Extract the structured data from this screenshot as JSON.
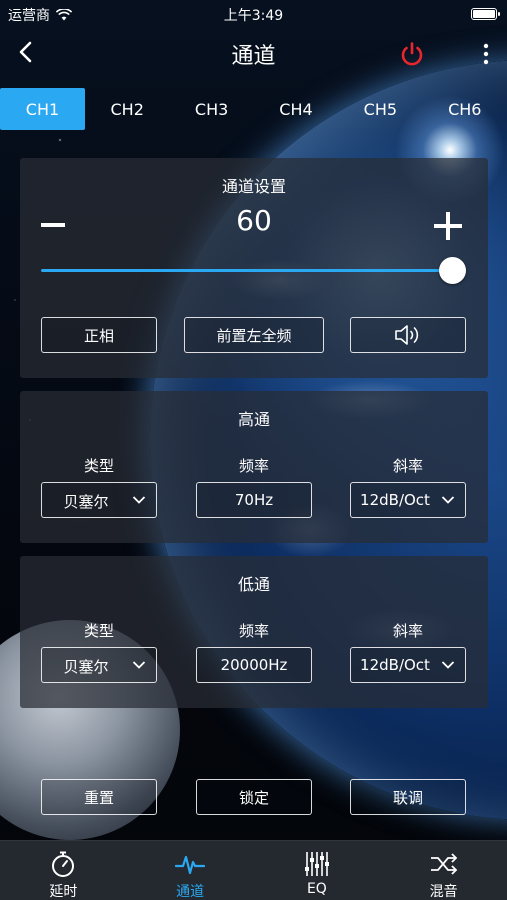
{
  "colors": {
    "accent": "#2aa8f2",
    "power": "#e8262c",
    "panel": "rgba(40,44,52,0.72)",
    "bottombar": "#262a32"
  },
  "status_bar": {
    "carrier": "运营商",
    "time": "上午3:49",
    "icons": [
      "wifi-icon",
      "battery-icon"
    ]
  },
  "nav": {
    "title": "通道",
    "icons": [
      "back-icon",
      "power-icon",
      "more-icon"
    ]
  },
  "tabs": [
    {
      "label": "CH1",
      "active": true
    },
    {
      "label": "CH2",
      "active": false
    },
    {
      "label": "CH3",
      "active": false
    },
    {
      "label": "CH4",
      "active": false
    },
    {
      "label": "CH5",
      "active": false
    },
    {
      "label": "CH6",
      "active": false
    }
  ],
  "channel_settings": {
    "title": "通道设置",
    "value": "60",
    "slider_level": 1.0,
    "minus_icon": "minus-icon",
    "plus_icon": "plus-icon",
    "buttons": {
      "phase": "正相",
      "source": "前置左全频",
      "speaker_icon": "speaker-icon"
    }
  },
  "highpass": {
    "title": "高通",
    "type_label": "类型",
    "freq_label": "频率",
    "slope_label": "斜率",
    "type_value": "贝塞尔",
    "freq_value": "70Hz",
    "slope_value": "12dB/Oct"
  },
  "lowpass": {
    "title": "低通",
    "type_label": "类型",
    "freq_label": "频率",
    "slope_label": "斜率",
    "type_value": "贝塞尔",
    "freq_value": "20000Hz",
    "slope_value": "12dB/Oct"
  },
  "actions": {
    "reset": "重置",
    "lock": "锁定",
    "link": "联调"
  },
  "bottom_nav": [
    {
      "label": "延时",
      "icon": "stopwatch-icon",
      "active": false
    },
    {
      "label": "通道",
      "icon": "waveform-icon",
      "active": true
    },
    {
      "label": "EQ",
      "icon": "equalizer-icon",
      "active": false
    },
    {
      "label": "混音",
      "icon": "shuffle-icon",
      "active": false
    }
  ]
}
